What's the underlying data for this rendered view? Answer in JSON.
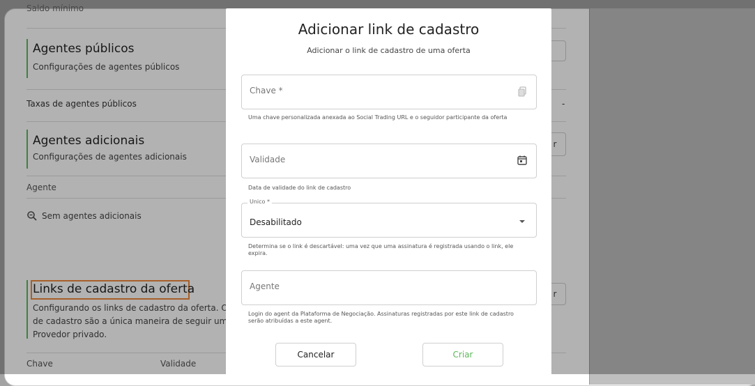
{
  "background": {
    "top_cut_label": "Saldo mínimo",
    "sections": {
      "agentes_publicos": {
        "title": "Agentes públicos",
        "subtitle": "Configurações de agentes públicos"
      },
      "taxas_label": "Taxas de agentes públicos",
      "agentes_adicionais": {
        "title": "Agentes adicionais",
        "subtitle": "Configurações de agentes adicionais"
      },
      "agente_column": "Agente",
      "empty_state": "Sem agentes adicionais",
      "links_cadastro": {
        "title": "Links de cadastro da oferta",
        "subtitle_line1": "Configurando os links de cadastro da oferta. Os li",
        "subtitle_line2": "de cadastro são a única maneira de seguir um",
        "subtitle_line3": "Provedor privado."
      },
      "table_columns": [
        "Chave",
        "Validade"
      ]
    },
    "right_fragments": {
      "button_r1": "r",
      "button_r2": "r",
      "dash": "-"
    }
  },
  "modal": {
    "title": "Adicionar link de cadastro",
    "subtitle": "Adicionar o link de cadastro de uma oferta",
    "fields": {
      "chave": {
        "placeholder": "Chave *",
        "helper": "Uma chave personalizada anexada ao Social Trading URL e o seguidor participante da oferta",
        "icon": "copy-icon"
      },
      "validade": {
        "placeholder": "Validade",
        "helper": "Data de validade do link de cadastro",
        "icon": "calendar-icon"
      },
      "unico": {
        "label": "Unico *",
        "value": "Desabilitado",
        "helper": "Determina se o link é descartável: uma vez que uma assinatura é registrada usando o link, ele expira.",
        "icon": "dropdown-arrow-icon"
      },
      "agente": {
        "placeholder": "Agente",
        "helper": "Login do agent da Plataforma de Negociação. Assinaturas registradas por este link de cadastro serão atribuídas a este agent."
      }
    },
    "buttons": {
      "cancel": "Cancelar",
      "create": "Criar"
    }
  },
  "colors": {
    "accent_green": "#5cb85c",
    "highlight_orange": "#f0883a"
  }
}
